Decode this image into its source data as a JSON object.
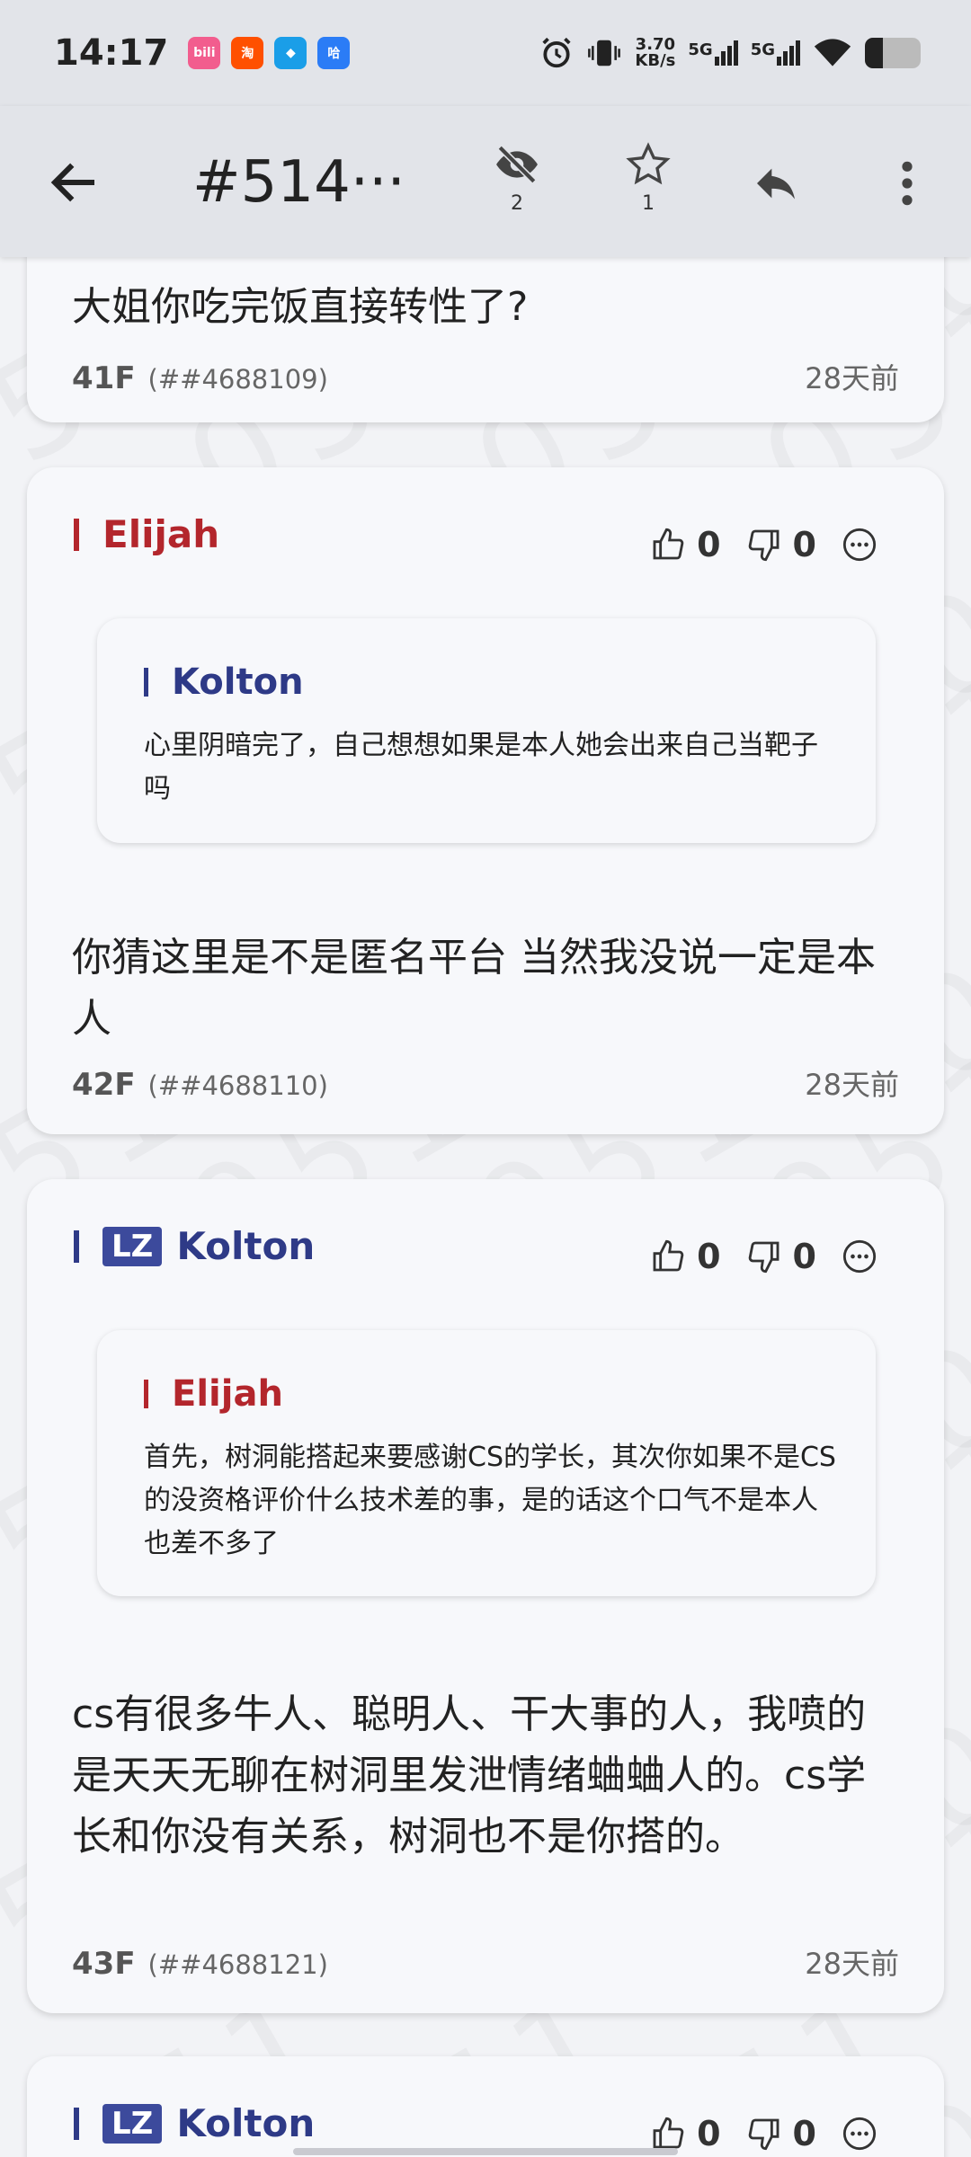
{
  "status_bar": {
    "time": "14:17",
    "net_speed_value": "3.70",
    "net_speed_unit": "KB/s",
    "signal1_label": "5G",
    "signal2_label": "5G",
    "battery_level": 0.32,
    "app_icons": [
      {
        "name": "bilibili-app-icon",
        "glyph": "bili",
        "color": "#f25d8e"
      },
      {
        "name": "taobao-app-icon",
        "glyph": "淘",
        "color": "#ff5000"
      },
      {
        "name": "square-app-icon",
        "glyph": "◆",
        "color": "#1a9ee8"
      },
      {
        "name": "hello-app-icon",
        "glyph": "哈",
        "color": "#2b7cf6"
      }
    ]
  },
  "app_bar": {
    "title": "#514···",
    "hidden_count": "2",
    "star_count": "1"
  },
  "posts": [
    {
      "body": "大姐你吃完饭直接转性了?",
      "floor": "41F",
      "pid": "(##4688109)",
      "time": "28天前"
    },
    {
      "author": "Elijah",
      "author_color": "#b3262c",
      "likes": "0",
      "dislikes": "0",
      "quote_author": "Kolton",
      "quote_author_color": "#2e3a87",
      "quote_text": "心里阴暗完了，自己想想如果是本人她会出来自己当靶子吗",
      "body": "你猜这里是不是匿名平台 当然我没说一定是本人",
      "floor": "42F",
      "pid": "(##4688110)",
      "time": "28天前"
    },
    {
      "author_badge": "LZ",
      "author": "Kolton",
      "author_color": "#2e3a87",
      "likes": "0",
      "dislikes": "0",
      "quote_author": "Elijah",
      "quote_author_color": "#b3262c",
      "quote_text": "首先，树洞能搭起来要感谢CS的学长，其次你如果不是CS的没资格评价什么技术差的事，是的话这个口气不是本人也差不多了",
      "body": "cs有很多牛人、聪明人、干大事的人，我喷的是天天无聊在树洞里发泄情绪蛐蛐人的。cs学长和你没有关系，树洞也不是你搭的。",
      "floor": "43F",
      "pid": "(##4688121)",
      "time": "28天前"
    },
    {
      "author_badge": "LZ",
      "author": "Kolton",
      "author_color": "#2e3a87",
      "likes": "0",
      "dislikes": "0"
    }
  ],
  "watermark_text": "051"
}
